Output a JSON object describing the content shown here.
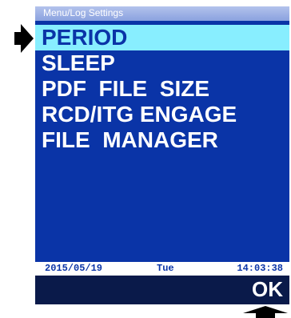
{
  "screen": {
    "title": "Menu/Log Settings",
    "menu_items": [
      {
        "label": "PERIOD",
        "selected": true
      },
      {
        "label": "SLEEP",
        "selected": false
      },
      {
        "label": "PDF  FILE  SIZE",
        "selected": false
      },
      {
        "label": "RCD/ITG ENGAGE",
        "selected": false
      },
      {
        "label": "FILE  MANAGER",
        "selected": false
      }
    ],
    "status": {
      "date": "2015/05/19",
      "day": "Tue",
      "time": "14:03:38"
    },
    "soft_key": {
      "ok_label": "OK"
    }
  },
  "colors": {
    "screen_background": "#0a34a7",
    "selected_row": "#88eeff",
    "title_bar": "#9fb2e6",
    "soft_key_bar": "#0a1a4a"
  },
  "icons": {
    "left_pointer": "right-arrow-icon",
    "bottom_pointer": "up-arrow-icon"
  }
}
